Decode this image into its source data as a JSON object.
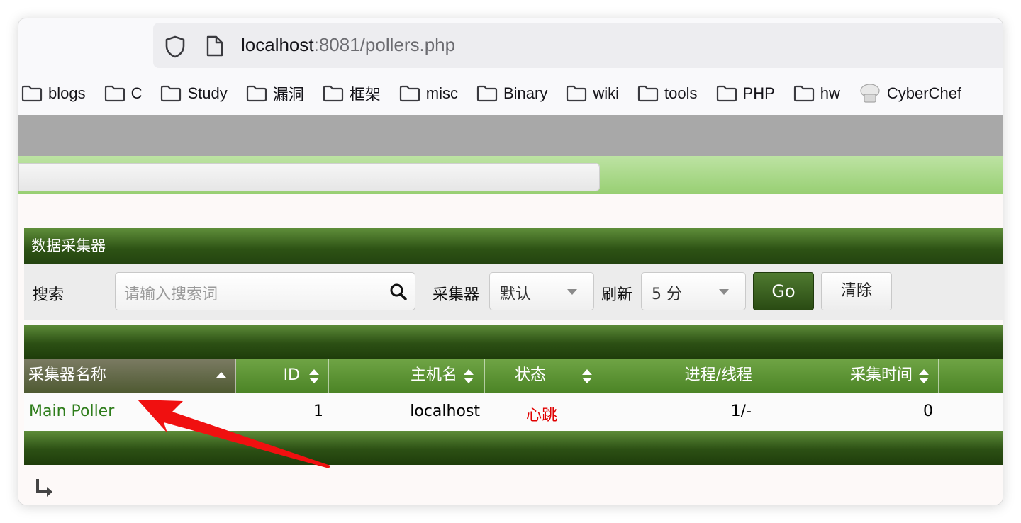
{
  "browser": {
    "url_host": "localhost",
    "url_path": ":8081/pollers.php",
    "bookmarks": [
      {
        "label": "blogs",
        "icon": "folder-icon"
      },
      {
        "label": "C",
        "icon": "folder-icon"
      },
      {
        "label": "Study",
        "icon": "folder-icon"
      },
      {
        "label": "漏洞",
        "icon": "folder-icon"
      },
      {
        "label": "框架",
        "icon": "folder-icon"
      },
      {
        "label": "misc",
        "icon": "folder-icon"
      },
      {
        "label": "Binary",
        "icon": "folder-icon"
      },
      {
        "label": "wiki",
        "icon": "folder-icon"
      },
      {
        "label": "tools",
        "icon": "folder-icon"
      },
      {
        "label": "PHP",
        "icon": "folder-icon"
      },
      {
        "label": "hw",
        "icon": "folder-icon"
      },
      {
        "label": "CyberChef",
        "icon": "chef-hat-icon"
      }
    ]
  },
  "panel": {
    "title": "数据采集器"
  },
  "filter": {
    "search_label": "搜索",
    "search_placeholder": "请输入搜索词",
    "poller_label": "采集器",
    "poller_value": "默认",
    "refresh_label": "刷新",
    "refresh_value": "5 分",
    "go_label": "Go",
    "clear_label": "清除"
  },
  "table": {
    "columns": [
      "采集器名称",
      "ID",
      "主机名",
      "状态",
      "进程/线程",
      "采集时间"
    ],
    "rows": [
      {
        "name": "Main Poller",
        "id": "1",
        "hostname": "localhost",
        "status": "心跳",
        "processes": "1/-",
        "time": "0"
      }
    ]
  },
  "colors": {
    "header_green": "#2d5214",
    "link_green": "#2e7d1b",
    "status_red": "#e00000",
    "annotation_red": "#f01010"
  }
}
